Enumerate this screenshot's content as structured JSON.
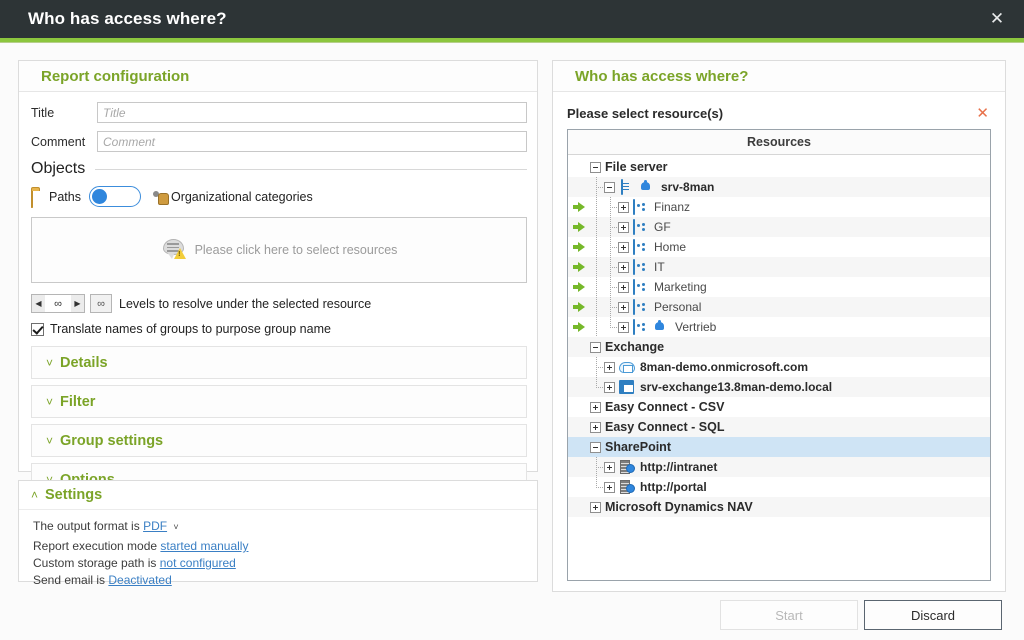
{
  "window": {
    "title": "Who has access where?",
    "close_icon": "close-icon",
    "accent_color": "#8cc63e",
    "titlebar_color": "#2d3436"
  },
  "left_panel": {
    "title": "Report configuration",
    "fields": [
      {
        "label": "Title",
        "value": "",
        "placeholder": "Title"
      },
      {
        "label": "Comment",
        "value": "",
        "placeholder": "Comment"
      }
    ],
    "objects": {
      "legend": "Objects",
      "toggle": {
        "left_label": "Paths",
        "left_icon": "folder-icon",
        "right_label": "Organizational categories",
        "right_icon": "org-categories-icon",
        "state": "left",
        "knob_color": "#2f86dd"
      },
      "dropzone": {
        "text": "Please click here to select resources",
        "icon": "speech-bubble-warning-icon"
      },
      "levels": {
        "spinner_value": "∞",
        "level_box_value": "∞",
        "label": "Levels to resolve under the selected resource",
        "dec_icon": "caret-left-icon",
        "inc_icon": "caret-right-icon"
      },
      "translate_checkbox": {
        "label": "Translate names of groups to purpose group name",
        "checked": true
      }
    },
    "accordions": [
      {
        "label": "Details",
        "expanded": false,
        "chevron": "chevron-down-icon"
      },
      {
        "label": "Filter",
        "expanded": false,
        "chevron": "chevron-down-icon"
      },
      {
        "label": "Group settings",
        "expanded": false,
        "chevron": "chevron-down-icon"
      },
      {
        "label": "Options",
        "expanded": false,
        "chevron": "chevron-down-icon"
      }
    ]
  },
  "settings_panel": {
    "title": "Settings",
    "expanded": true,
    "chevron": "chevron-up-icon",
    "lines": {
      "output_prefix": "The output format is",
      "output_value": "PDF",
      "output_caret": "chevron-down-icon",
      "exec_prefix": "Report execution mode",
      "exec_value": "started manually",
      "storage_prefix": "Custom storage path is",
      "storage_value": "not configured",
      "email_prefix": "Send email is",
      "email_value": "Deactivated"
    },
    "link_color": "#3a7fc4"
  },
  "right_panel": {
    "title": "Who has access where?",
    "subtitle": "Please select resource(s)",
    "close_icon": "close-icon",
    "tree_header": "Resources",
    "tree": [
      {
        "label": "File server",
        "level": 0,
        "style": "root",
        "expander": "minus",
        "icons": [],
        "arrow": false,
        "selected": false,
        "alt": false
      },
      {
        "label": "srv-8man",
        "level": 1,
        "style": "bold",
        "expander": "minus",
        "icons": [
          "server-icon",
          "bell-icon"
        ],
        "arrow": false,
        "selected": false,
        "alt": true
      },
      {
        "label": "Finanz",
        "level": 2,
        "style": "plain",
        "expander": "plus",
        "icons": [
          "share-folder-icon"
        ],
        "arrow": true,
        "selected": false,
        "alt": false
      },
      {
        "label": "GF",
        "level": 2,
        "style": "plain",
        "expander": "plus",
        "icons": [
          "share-folder-icon"
        ],
        "arrow": true,
        "selected": false,
        "alt": true
      },
      {
        "label": "Home",
        "level": 2,
        "style": "plain",
        "expander": "plus",
        "icons": [
          "share-folder-icon"
        ],
        "arrow": true,
        "selected": false,
        "alt": false
      },
      {
        "label": "IT",
        "level": 2,
        "style": "plain",
        "expander": "plus",
        "icons": [
          "share-folder-icon"
        ],
        "arrow": true,
        "selected": false,
        "alt": true
      },
      {
        "label": "Marketing",
        "level": 2,
        "style": "plain",
        "expander": "plus",
        "icons": [
          "share-folder-icon"
        ],
        "arrow": true,
        "selected": false,
        "alt": false
      },
      {
        "label": "Personal",
        "level": 2,
        "style": "plain",
        "expander": "plus",
        "icons": [
          "share-folder-icon"
        ],
        "arrow": true,
        "selected": false,
        "alt": true
      },
      {
        "label": "Vertrieb",
        "level": 2,
        "style": "plain",
        "expander": "plus",
        "icons": [
          "share-folder-icon",
          "bell-icon"
        ],
        "arrow": true,
        "selected": false,
        "alt": false
      },
      {
        "label": "Exchange",
        "level": 0,
        "style": "root",
        "expander": "minus",
        "icons": [],
        "arrow": false,
        "selected": false,
        "alt": true
      },
      {
        "label": "8man-demo.onmicrosoft.com",
        "level": 1,
        "style": "bold",
        "expander": "plus",
        "icons": [
          "cloud-mail-icon"
        ],
        "arrow": false,
        "selected": false,
        "alt": false
      },
      {
        "label": "srv-exchange13.8man-demo.local",
        "level": 1,
        "style": "bold",
        "expander": "plus",
        "icons": [
          "exchange-server-icon"
        ],
        "arrow": false,
        "selected": false,
        "alt": true
      },
      {
        "label": "Easy Connect - CSV",
        "level": 0,
        "style": "root",
        "expander": "plus",
        "icons": [],
        "arrow": false,
        "selected": false,
        "alt": false
      },
      {
        "label": "Easy Connect - SQL",
        "level": 0,
        "style": "root",
        "expander": "plus",
        "icons": [],
        "arrow": false,
        "selected": false,
        "alt": true
      },
      {
        "label": "SharePoint",
        "level": 0,
        "style": "root",
        "expander": "minus",
        "icons": [],
        "arrow": false,
        "selected": true,
        "alt": false
      },
      {
        "label": "http://intranet",
        "level": 1,
        "style": "bold",
        "expander": "plus",
        "icons": [
          "sharepoint-site-icon"
        ],
        "arrow": false,
        "selected": false,
        "alt": true
      },
      {
        "label": "http://portal",
        "level": 1,
        "style": "bold",
        "expander": "plus",
        "icons": [
          "sharepoint-site-icon"
        ],
        "arrow": false,
        "selected": false,
        "alt": false
      },
      {
        "label": "Microsoft Dynamics NAV",
        "level": 0,
        "style": "root",
        "expander": "plus",
        "icons": [],
        "arrow": false,
        "selected": false,
        "alt": true
      }
    ]
  },
  "footer": {
    "start_label": "Start",
    "start_enabled": false,
    "discard_label": "Discard"
  }
}
